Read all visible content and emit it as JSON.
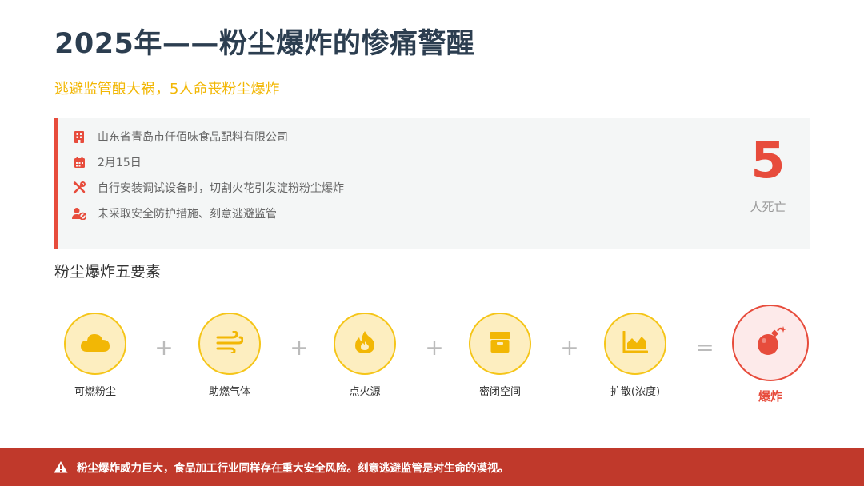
{
  "header": {
    "title": "2025年——粉尘爆炸的惨痛警醒",
    "subtitle": "逃避监管酿大祸，5人命丧粉尘爆炸"
  },
  "incident": {
    "rows": [
      {
        "icon": "building-icon",
        "text": "山东省青岛市仟佰味食品配料有限公司"
      },
      {
        "icon": "calendar-icon",
        "text": "2月15日"
      },
      {
        "icon": "tools-icon",
        "text": "自行安装调试设备时，切割火花引发淀粉粉尘爆炸"
      },
      {
        "icon": "user-ban-icon",
        "text": "未采取安全防护措施、刻意逃避监管"
      }
    ],
    "death_count": "5",
    "death_label": "人死亡"
  },
  "elements": {
    "section_title": "粉尘爆炸五要素",
    "items": [
      {
        "icon": "cloud-icon",
        "label": "可燃粉尘"
      },
      {
        "icon": "wind-icon",
        "label": "助燃气体"
      },
      {
        "icon": "fire-icon",
        "label": "点火源"
      },
      {
        "icon": "box-icon",
        "label": "密闭空间"
      },
      {
        "icon": "area-chart-icon",
        "label": "扩散(浓度)"
      }
    ],
    "plus": "+",
    "equals": "=",
    "result": {
      "icon": "bomb-icon",
      "label": "爆炸"
    }
  },
  "footer": {
    "icon": "warning-icon",
    "text": "粉尘爆炸威力巨大，食品加工行业同样存在重大安全风险。刻意逃避监管是对生命的漠视。"
  },
  "colors": {
    "title": "#2c3e50",
    "accent_yellow": "#f2b705",
    "accent_red": "#e74c3c",
    "footer_bg": "#c0392b",
    "card_bg": "#f4f6f6"
  }
}
